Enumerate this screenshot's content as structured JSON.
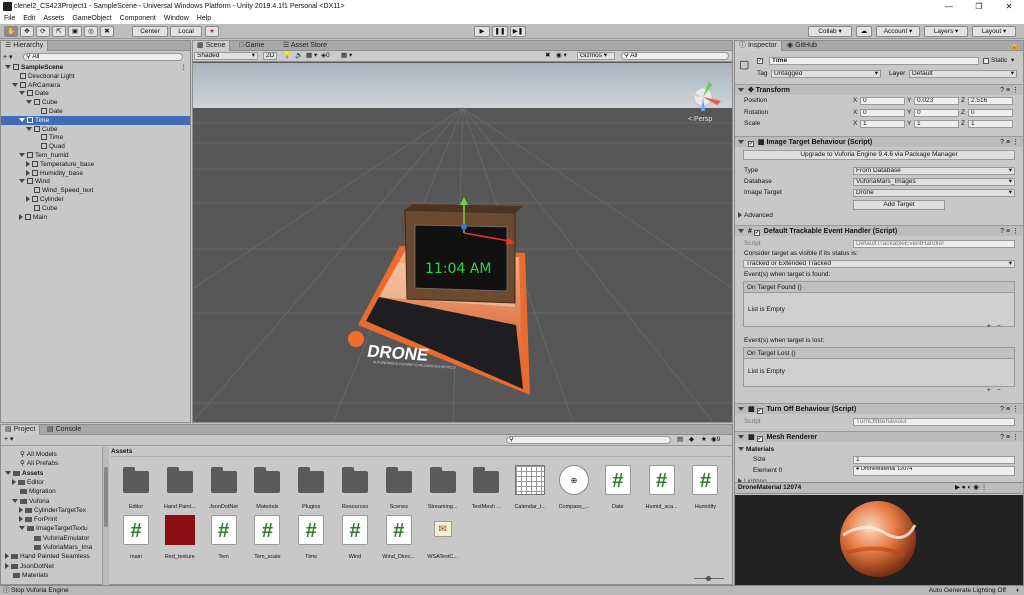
{
  "window": {
    "title": "clenel2_CS423Project1 - SampleScene - Universal Windows Platform - Unity 2019.4.1f1 Personal <DX11>"
  },
  "menu": [
    "File",
    "Edit",
    "Assets",
    "GameObject",
    "Component",
    "Window",
    "Help"
  ],
  "toolbar": {
    "center": "Center",
    "local": "Local",
    "collab": "Collab",
    "account": "Account",
    "layers": "Layers",
    "layout": "Layout"
  },
  "hierarchy": {
    "tab": "Hierarchy",
    "search": "All",
    "items": [
      {
        "label": "SampleScene",
        "depth": 0,
        "kind": "scene",
        "expanded": true
      },
      {
        "label": "Directional Light",
        "depth": 1,
        "kind": "leaf"
      },
      {
        "label": "ARCamera",
        "depth": 1,
        "kind": "open"
      },
      {
        "label": "Date",
        "depth": 2,
        "kind": "open"
      },
      {
        "label": "Cube",
        "depth": 3,
        "kind": "open"
      },
      {
        "label": "Date",
        "depth": 4,
        "kind": "leaf"
      },
      {
        "label": "Time",
        "depth": 2,
        "kind": "open",
        "selected": true
      },
      {
        "label": "Cube",
        "depth": 3,
        "kind": "open"
      },
      {
        "label": "Time",
        "depth": 4,
        "kind": "leaf"
      },
      {
        "label": "Quad",
        "depth": 4,
        "kind": "leaf"
      },
      {
        "label": "Tem_humid",
        "depth": 2,
        "kind": "open"
      },
      {
        "label": "Temperature_base",
        "depth": 3,
        "kind": "closed"
      },
      {
        "label": "Humidity_base",
        "depth": 3,
        "kind": "closed"
      },
      {
        "label": "Wind",
        "depth": 2,
        "kind": "open"
      },
      {
        "label": "Wind_Speed_text",
        "depth": 3,
        "kind": "leaf"
      },
      {
        "label": "Cylinder",
        "depth": 3,
        "kind": "closed"
      },
      {
        "label": "Cube",
        "depth": 3,
        "kind": "leaf"
      },
      {
        "label": "Main",
        "depth": 2,
        "kind": "closed"
      }
    ]
  },
  "scene": {
    "tabs": [
      "Scene",
      "Game",
      "Asset Store"
    ],
    "shaded": "Shaded",
    "mode2d": "2D",
    "fx_count": "0",
    "gizmos": "Gizmos",
    "search": "All",
    "persp": "< Persp",
    "clock_text": "11:04 AM",
    "drone_title": "DRONE",
    "drone_sub": "AUTONOMOUS RUNWAY EXPLORATION VEHICLE"
  },
  "inspector": {
    "tabs": [
      "Inspector",
      "GitHub"
    ],
    "object_name": "Time",
    "static": "Static",
    "tag_label": "Tag",
    "tag": "Untagged",
    "layer_label": "Layer",
    "layer": "Default",
    "transform": {
      "title": "Transform",
      "rows": [
        {
          "label": "Position",
          "x": "0",
          "y": "0.023",
          "z": "2.516"
        },
        {
          "label": "Rotation",
          "x": "0",
          "y": "0",
          "z": "0"
        },
        {
          "label": "Scale",
          "x": "1",
          "y": "1",
          "z": "1"
        }
      ]
    },
    "itb": {
      "title": "Image Target Behaviour (Script)",
      "upgrade": "Upgrade to Vuforia Engine 9.4.6 via Package Manager",
      "type_label": "Type",
      "type": "From Database",
      "db_label": "Database",
      "db": "VuforiaMars_Images",
      "target_label": "Image Target",
      "target": "Drone",
      "add_target": "Add Target",
      "advanced": "Advanced"
    },
    "dteh": {
      "title": "Default Trackable Event Handler (Script)",
      "script_label": "Script",
      "script": "DefaultTrackableEventHandler",
      "consider": "Consider target as visible if its status is:",
      "status": "Tracked or Extended Tracked",
      "found_label": "Event(s) when target is found:",
      "found_head": "On Target Found ()",
      "found_empty": "List is Empty",
      "lost_label": "Event(s) when target is lost:",
      "lost_head": "On Target Lost ()",
      "lost_empty": "List is Empty"
    },
    "tob": {
      "title": "Turn Off Behaviour (Script)",
      "script_label": "Script",
      "script": "TurnOffBehaviour"
    },
    "mesh": {
      "title": "Mesh Renderer",
      "materials": "Materials",
      "size_label": "Size",
      "size": "1",
      "element_label": "Element 0",
      "element": "DroneMaterial 12074",
      "lighting": "Lighting"
    },
    "preview_label": "DroneMaterial 12074"
  },
  "project": {
    "tabs": [
      "Project",
      "Console"
    ],
    "tree": [
      {
        "label": "All Models",
        "depth": 1,
        "kind": "search"
      },
      {
        "label": "All Prefabs",
        "depth": 1,
        "kind": "search"
      },
      {
        "label": "Assets",
        "depth": 0,
        "kind": "open",
        "bold": true
      },
      {
        "label": "Editor",
        "depth": 1,
        "kind": "closed"
      },
      {
        "label": "Migration",
        "depth": 1,
        "kind": "leaf"
      },
      {
        "label": "Vuforia",
        "depth": 1,
        "kind": "open"
      },
      {
        "label": "CylinderTargetTex",
        "depth": 2,
        "kind": "closed"
      },
      {
        "label": "ForPrint",
        "depth": 2,
        "kind": "closed"
      },
      {
        "label": "ImageTargetTextu",
        "depth": 2,
        "kind": "open"
      },
      {
        "label": "VuforiaEmulator",
        "depth": 3,
        "kind": "leaf"
      },
      {
        "label": "VuforiaMars_Ima",
        "depth": 3,
        "kind": "leaf"
      },
      {
        "label": "Hand Painted Seamless",
        "depth": 0,
        "kind": "closed"
      },
      {
        "label": "JsonDotNet",
        "depth": 0,
        "kind": "closed"
      },
      {
        "label": "Materials",
        "depth": 0,
        "kind": "leaf"
      }
    ],
    "breadcrumb": "Assets",
    "fav_count": "9",
    "assets_row1": [
      {
        "name": "Editor",
        "kind": "folder"
      },
      {
        "name": "Hand Paint...",
        "kind": "folder"
      },
      {
        "name": "JsonDotNet",
        "kind": "folder"
      },
      {
        "name": "Materials",
        "kind": "folder"
      },
      {
        "name": "Plugins",
        "kind": "folder"
      },
      {
        "name": "Resources",
        "kind": "folder"
      },
      {
        "name": "Scenes",
        "kind": "folder"
      },
      {
        "name": "Streaming...",
        "kind": "folder"
      },
      {
        "name": "TextMesh ...",
        "kind": "folder"
      },
      {
        "name": "Calendar_t...",
        "kind": "calendar"
      },
      {
        "name": "Compass_...",
        "kind": "compass"
      },
      {
        "name": "Date",
        "kind": "script"
      },
      {
        "name": "Humid_sca...",
        "kind": "script"
      },
      {
        "name": "Humidity",
        "kind": "script"
      }
    ],
    "assets_row2": [
      {
        "name": "main",
        "kind": "script"
      },
      {
        "name": "Red_texture",
        "kind": "red"
      },
      {
        "name": "Tem",
        "kind": "script"
      },
      {
        "name": "Tem_scale",
        "kind": "script"
      },
      {
        "name": "Time",
        "kind": "script"
      },
      {
        "name": "Wind",
        "kind": "script"
      },
      {
        "name": "Wind_Direc...",
        "kind": "script"
      },
      {
        "name": "WSATestC...",
        "kind": "cert"
      }
    ]
  },
  "status": {
    "left": "Stop Vuforia Engine",
    "right": "Auto Generate Lighting Off"
  },
  "colors": {
    "selection": "#3e6db5",
    "clock_green": "#27d84a",
    "drone_orange": "#f26d2c"
  }
}
